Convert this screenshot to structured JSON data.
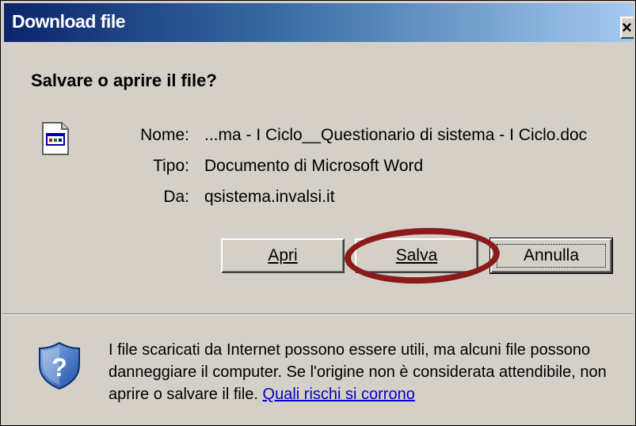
{
  "window": {
    "title": "Download file",
    "close_label": "×"
  },
  "dialog": {
    "heading": "Salvare o aprire il file?",
    "file": {
      "name_label": "Nome:",
      "name_value": "...ma - I Ciclo__Questionario di sistema - I Ciclo.doc",
      "type_label": "Tipo:",
      "type_value": "Documento di Microsoft Word",
      "from_label": "Da:",
      "from_value": "qsistema.invalsi.it"
    },
    "buttons": {
      "open_label": "Apri",
      "save_label": "Salva",
      "cancel_label": "Annulla"
    },
    "warning": {
      "text": "I file scaricati da Internet possono essere utili, ma alcuni file possono danneggiare il computer. Se l'origine non è considerata attendibile, non aprire o salvare il file. ",
      "link_text": "Quali rischi si corrono"
    }
  },
  "icons": {
    "file": "word-document-icon",
    "shield": "security-shield-icon"
  },
  "colors": {
    "titlebar_start": "#0a246a",
    "titlebar_end": "#a6caf0",
    "dialog_bg": "#d4d0c8",
    "annotation": "#8b1a1a",
    "link": "#0000cc"
  }
}
